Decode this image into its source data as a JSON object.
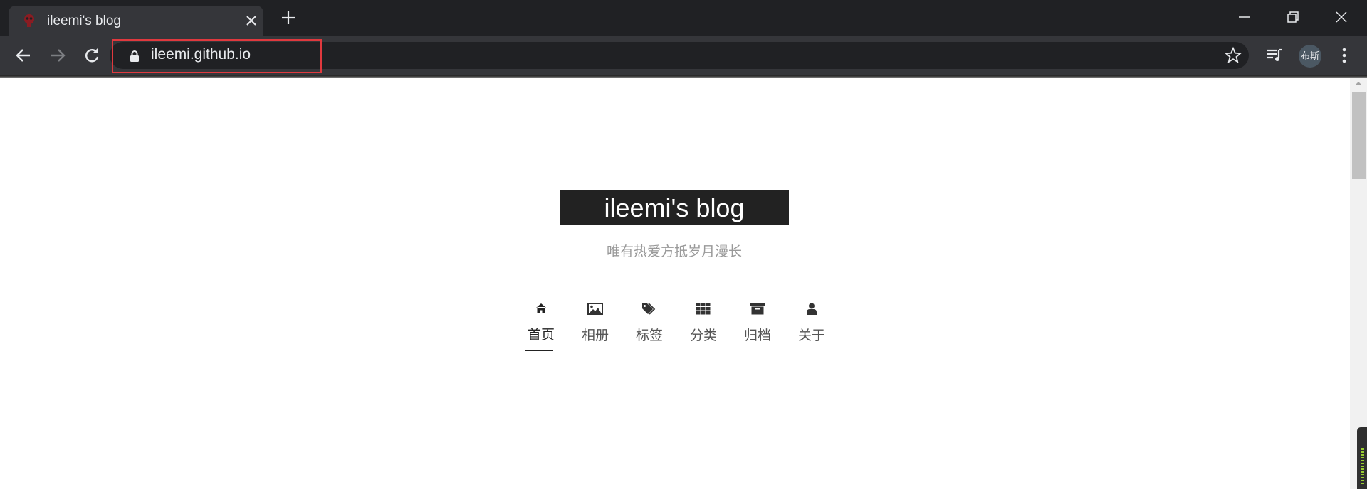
{
  "browser": {
    "tab_title": "ileemi's blog",
    "url": "ileemi.github.io",
    "avatar_text": "布斯",
    "highlight_color": "#e0393e"
  },
  "page": {
    "title": "ileemi's blog",
    "subtitle": "唯有热爱方抵岁月漫长",
    "menu": [
      {
        "label": "首页",
        "icon": "home-icon",
        "active": true
      },
      {
        "label": "相册",
        "icon": "image-icon",
        "active": false
      },
      {
        "label": "标签",
        "icon": "tags-icon",
        "active": false
      },
      {
        "label": "分类",
        "icon": "grid-icon",
        "active": false
      },
      {
        "label": "归档",
        "icon": "archive-icon",
        "active": false
      },
      {
        "label": "关于",
        "icon": "user-icon",
        "active": false
      }
    ]
  },
  "colors": {
    "tabstrip": "#202124",
    "toolbar": "#35363a",
    "title_bg": "#222222",
    "subtitle": "#999999"
  }
}
